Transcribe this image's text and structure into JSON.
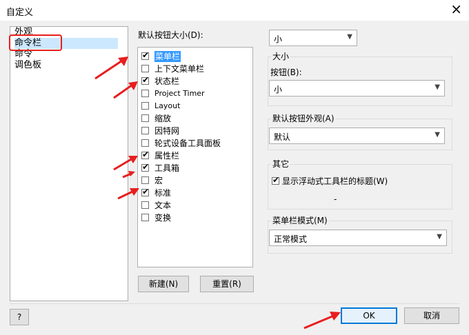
{
  "window": {
    "title": "自定义",
    "close_icon": "×"
  },
  "sidebar": {
    "items": [
      {
        "label": "外观"
      },
      {
        "label": "命令栏",
        "selected": true
      },
      {
        "label": "命令"
      },
      {
        "label": "调色板"
      }
    ]
  },
  "main": {
    "default_size_label": "默认按钮大小(D):",
    "default_size_value": "小",
    "list": [
      {
        "label": "菜单栏",
        "checked": true,
        "highlighted": true
      },
      {
        "label": "上下文菜单栏",
        "checked": false
      },
      {
        "label": "状态栏",
        "checked": true
      },
      {
        "label": "Project Timer",
        "checked": false
      },
      {
        "label": "Layout",
        "checked": false
      },
      {
        "label": "缩放",
        "checked": false
      },
      {
        "label": "因特网",
        "checked": false
      },
      {
        "label": "轮式设备工具面板",
        "checked": false
      },
      {
        "label": "属性栏",
        "checked": true
      },
      {
        "label": "工具箱",
        "checked": true
      },
      {
        "label": "宏",
        "checked": false
      },
      {
        "label": "标准",
        "checked": true
      },
      {
        "label": "文本",
        "checked": false
      },
      {
        "label": "变换",
        "checked": false
      }
    ],
    "new_button": "新建(N)",
    "reset_button": "重置(R)"
  },
  "right": {
    "size_group_title": "大小",
    "button_label": "按钮(B):",
    "button_value": "小",
    "appearance_group_title": "默认按钮外观(A)",
    "appearance_value": "默认",
    "other_group_title": "其它",
    "show_title_label": "显示浮动式工具栏的标题(W)",
    "show_title_checked": true,
    "dash": "-",
    "menubar_mode_group_title": "菜单栏模式(M)",
    "menubar_mode_value": "正常模式"
  },
  "footer": {
    "help": "?",
    "ok": "OK",
    "cancel": "取消"
  },
  "colors": {
    "accent": "#0078d7",
    "annotation": "#e81e1e",
    "selection": "#cce8ff",
    "highlight": "#3399ff"
  },
  "icons": {
    "dropdown": "chevron-down-icon",
    "check": "checkmark-icon",
    "annotation_arrow": "arrow-icon"
  }
}
